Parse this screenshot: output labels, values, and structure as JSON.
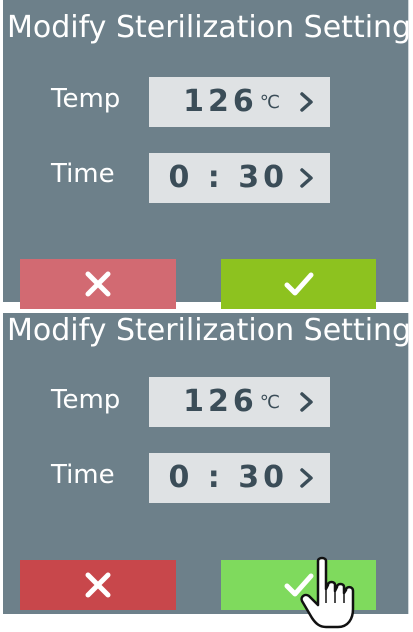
{
  "screens": [
    {
      "title": "Modify Sterilization Setting",
      "temp": {
        "label": "Temp",
        "value": "126",
        "unit": "℃"
      },
      "time": {
        "label": "Time",
        "value": "0 : 30"
      },
      "cancel_icon": "close-icon",
      "confirm_icon": "checkmark-icon",
      "colors": {
        "panel": "#6d808a",
        "cancel": "#d26a72",
        "confirm": "#8dc21f"
      }
    },
    {
      "title": "Modify Sterilization Setting",
      "temp": {
        "label": "Temp",
        "value": "126",
        "unit": "℃"
      },
      "time": {
        "label": "Time",
        "value": "0 : 30"
      },
      "cancel_icon": "close-icon",
      "confirm_icon": "checkmark-icon",
      "colors": {
        "panel": "#6d808a",
        "cancel": "#c8474b",
        "confirm": "#7fda5d"
      }
    }
  ],
  "cursor_icon": "hand-pointer-icon"
}
